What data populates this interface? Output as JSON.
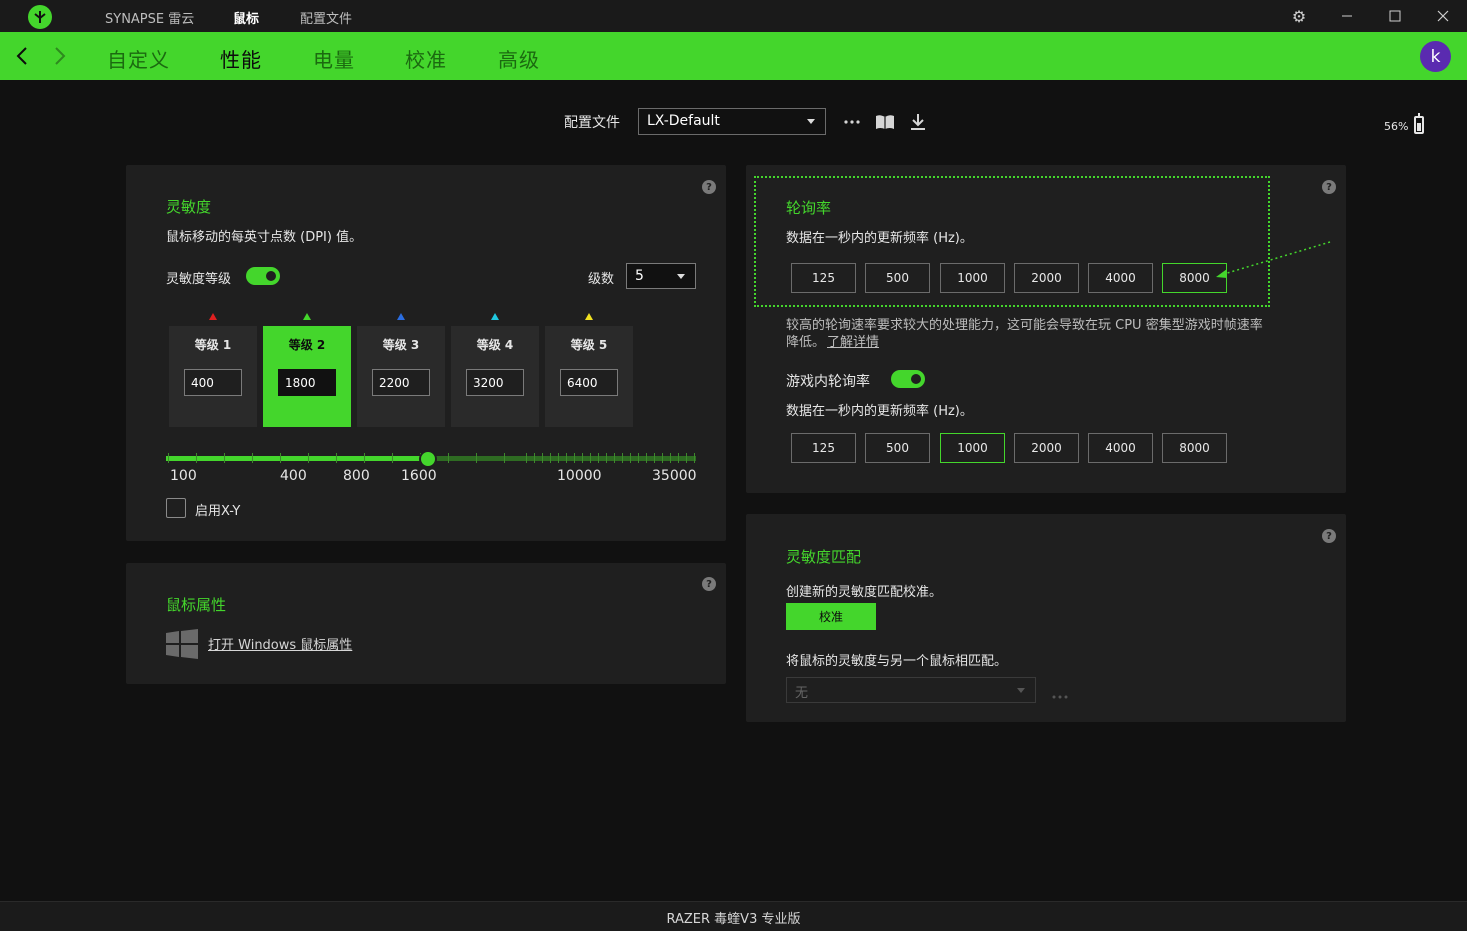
{
  "titlebar": {
    "app_name": "SYNAPSE 雷云",
    "tabs": [
      "鼠标",
      "配置文件"
    ]
  },
  "nav": {
    "tabs": [
      "自定义",
      "性能",
      "电量",
      "校准",
      "高级"
    ],
    "active_index": 1,
    "avatar_letter": "k"
  },
  "profile": {
    "label": "配置文件",
    "selected": "LX-Default"
  },
  "battery": {
    "percent_label": "56%",
    "level": 56
  },
  "sensitivity": {
    "title": "灵敏度",
    "description": "鼠标移动的每英寸点数 (DPI) 值。",
    "stages_label": "灵敏度等级",
    "stages_enabled": true,
    "levels_label": "级数",
    "levels_value": "5",
    "stages": [
      {
        "label": "等级 1",
        "value": "400",
        "color": "#e02020"
      },
      {
        "label": "等级 2",
        "value": "1800",
        "color": "#44d62c"
      },
      {
        "label": "等级 3",
        "value": "2200",
        "color": "#2a6de0"
      },
      {
        "label": "等级 4",
        "value": "3200",
        "color": "#20c8e0"
      },
      {
        "label": "等级 5",
        "value": "6400",
        "color": "#f0e020"
      }
    ],
    "active_stage": 1,
    "slider_ticks": [
      "100",
      "400",
      "800",
      "1600",
      "10000",
      "35000"
    ],
    "slider_value": 1800,
    "xy_label": "启用X-Y"
  },
  "mouse_props": {
    "title": "鼠标属性",
    "link_text": "打开 Windows 鼠标属性"
  },
  "polling": {
    "title": "轮询率",
    "description": "数据在一秒内的更新频率 (Hz)。",
    "options": [
      "125",
      "500",
      "1000",
      "2000",
      "4000",
      "8000"
    ],
    "selected": "8000",
    "warning": "较高的轮询速率要求较大的处理能力，这可能会导致在玩 CPU 密集型游戏时帧速率",
    "warning_line2": "降低。",
    "learn_more": "了解详情",
    "ingame_title": "游戏内轮询率",
    "ingame_enabled": true,
    "ingame_description": "数据在一秒内的更新频率 (Hz)。",
    "ingame_selected": "1000"
  },
  "sens_match": {
    "title": "灵敏度匹配",
    "description": "创建新的灵敏度匹配校准。",
    "button": "校准",
    "match_description": "将鼠标的灵敏度与另一个鼠标相匹配。",
    "select_value": "无"
  },
  "footer": {
    "device": "RAZER 毒蝰V3 专业版"
  }
}
